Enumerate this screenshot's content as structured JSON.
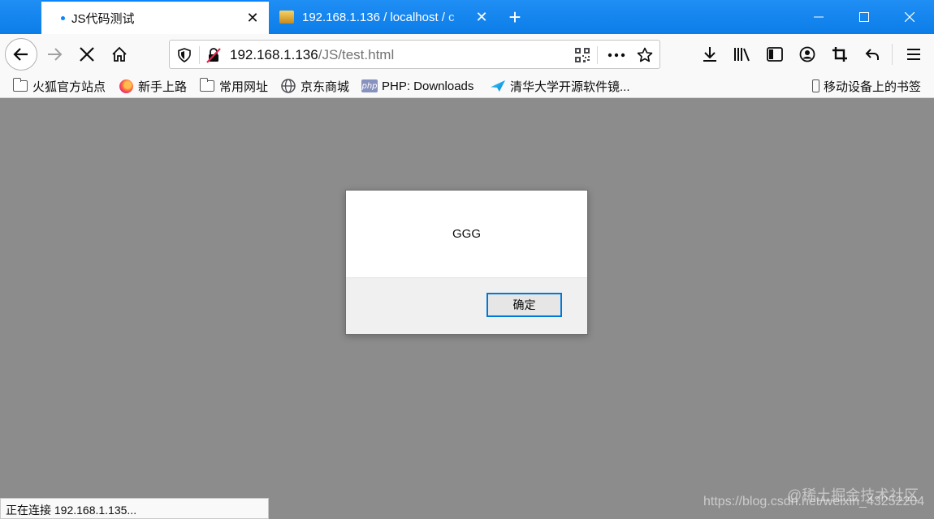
{
  "tabs": [
    {
      "title": "JS代码测试",
      "active": true
    },
    {
      "title": "192.168.1.136 / localhost / c",
      "active": false
    }
  ],
  "url": {
    "host": "192.168.1.136",
    "path": "/JS/test.html"
  },
  "bookmarks": [
    {
      "label": "火狐官方站点",
      "icon": "folder-icon"
    },
    {
      "label": "新手上路",
      "icon": "firefox-icon"
    },
    {
      "label": "常用网址",
      "icon": "folder-icon"
    },
    {
      "label": "京东商城",
      "icon": "globe-icon"
    },
    {
      "label": "PHP: Downloads",
      "icon": "php-icon"
    },
    {
      "label": "清华大学开源软件镜...",
      "icon": "bird-icon"
    },
    {
      "label": "移动设备上的书签",
      "icon": "phone-icon"
    }
  ],
  "dialog": {
    "message": "GGG",
    "ok_label": "确定"
  },
  "status": "正在连接 192.168.1.135...",
  "watermark": {
    "url": "https://blog.csdn.net/weixin_43252204",
    "brand": "@稀土掘金技术社区"
  },
  "colors": {
    "tabbar": "#0a84ff",
    "content_bg": "#8c8c8c",
    "button_focus": "#0078d7"
  }
}
